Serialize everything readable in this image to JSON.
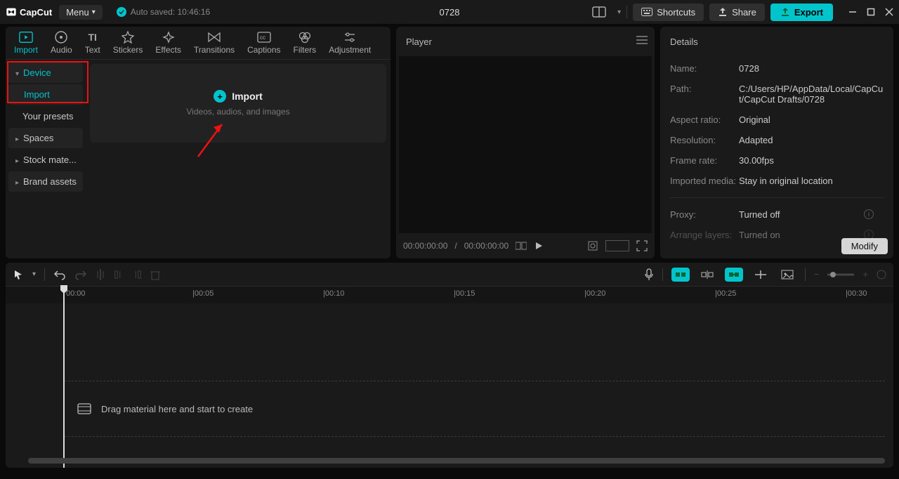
{
  "app": {
    "name": "CapCut"
  },
  "titlebar": {
    "menu": "Menu",
    "autosave": "Auto saved: 10:46:16",
    "project_title": "0728",
    "shortcuts": "Shortcuts",
    "share": "Share",
    "export": "Export"
  },
  "media_tabs": [
    {
      "label": "Import",
      "active": true
    },
    {
      "label": "Audio"
    },
    {
      "label": "Text"
    },
    {
      "label": "Stickers"
    },
    {
      "label": "Effects"
    },
    {
      "label": "Transitions"
    },
    {
      "label": "Captions"
    },
    {
      "label": "Filters"
    },
    {
      "label": "Adjustment"
    }
  ],
  "categories": {
    "device": "Device",
    "import": "Import",
    "presets": "Your presets",
    "spaces": "Spaces",
    "stock": "Stock mate...",
    "brand": "Brand assets"
  },
  "import_drop": {
    "title": "Import",
    "subtitle": "Videos, audios, and images"
  },
  "player": {
    "title": "Player",
    "time_current": "00:00:00:00",
    "time_sep": "/",
    "time_total": "00:00:00:00"
  },
  "details": {
    "title": "Details",
    "rows": {
      "name_label": "Name:",
      "name_val": "0728",
      "path_label": "Path:",
      "path_val": "C:/Users/HP/AppData/Local/CapCut/CapCut Drafts/0728",
      "aspect_label": "Aspect ratio:",
      "aspect_val": "Original",
      "res_label": "Resolution:",
      "res_val": "Adapted",
      "fps_label": "Frame rate:",
      "fps_val": "30.00fps",
      "media_label": "Imported media:",
      "media_val": "Stay in original location",
      "proxy_label": "Proxy:",
      "proxy_val": "Turned off",
      "layers_label": "Arrange layers:",
      "layers_val": "Turned on"
    },
    "modify": "Modify"
  },
  "timeline": {
    "ticks": [
      "00:00",
      "|00:05",
      "|00:10",
      "|00:15",
      "|00:20",
      "|00:25",
      "|00:30"
    ],
    "drop_hint": "Drag material here and start to create"
  }
}
